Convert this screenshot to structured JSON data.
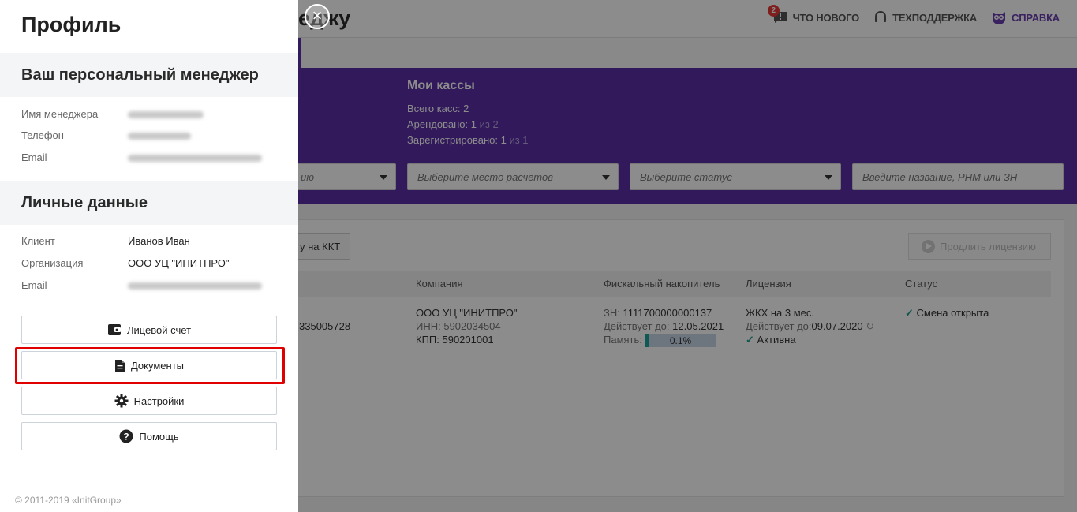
{
  "app": {
    "page_title_fragment": "еджу",
    "top_links": {
      "whats_new": "ЧТО НОВОГО",
      "whats_new_badge": "2",
      "support": "ТЕХПОДДЕРЖКА",
      "help": "СПРАВКА"
    },
    "kassy": {
      "title": "Мои кассы",
      "total_label": "Всего касс:",
      "total_value": "2",
      "rented_label": "Арендовано:",
      "rented_value": "1",
      "rented_of": "из 2",
      "registered_label": "Зарегистрировано:",
      "registered_value": "1",
      "registered_of": "из 1"
    },
    "filters": {
      "filter1_fragment": "ию",
      "place": "Выберите место расчетов",
      "status": "Выберите статус",
      "search_placeholder": "Введите название, РНМ или ЗН"
    },
    "actions": {
      "kkt_button_fragment": "у на ККТ",
      "renew_license": "Продлить лицензию"
    },
    "table": {
      "headers": {
        "company": "Компания",
        "fiscal": "Фискальный накопитель",
        "license": "Лицензия",
        "status": "Статус"
      },
      "row": {
        "id_fragment": "335005728",
        "company_name": "ООО УЦ \"ИНИТПРО\"",
        "inn": "ИНН: 5902034504",
        "kpp": "КПП: 590201001",
        "fn_label": "ЗН:",
        "fn_value": "1111700000000137",
        "fn_valid_label": "Действует до:",
        "fn_valid_value": "12.05.2021",
        "memory_label": "Память:",
        "memory_value": "0.1%",
        "license_name": "ЖКХ на 3 мес.",
        "license_valid_label": "Действует до:",
        "license_valid_value": "09.07.2020",
        "license_state": "Активна",
        "status": "Смена открыта"
      }
    }
  },
  "panel": {
    "title": "Профиль",
    "manager_section": "Ваш персональный менеджер",
    "manager_name_label": "Имя менеджера",
    "manager_phone_label": "Телефон",
    "manager_email_label": "Email",
    "personal_section": "Личные данные",
    "client_label": "Клиент",
    "client_value": "Иванов Иван",
    "org_label": "Организация",
    "org_value": "ООО УЦ \"ИНИТПРО\"",
    "email_label": "Email",
    "buttons": {
      "account": "Лицевой счет",
      "documents": "Документы",
      "settings": "Настройки",
      "help": "Помощь"
    },
    "copyright": "© 2011-2019 «InitGroup»"
  },
  "colors": {
    "brand_purple": "#5b2ea8",
    "highlight_red": "#e00000",
    "accent_teal": "#1f9c8c"
  }
}
